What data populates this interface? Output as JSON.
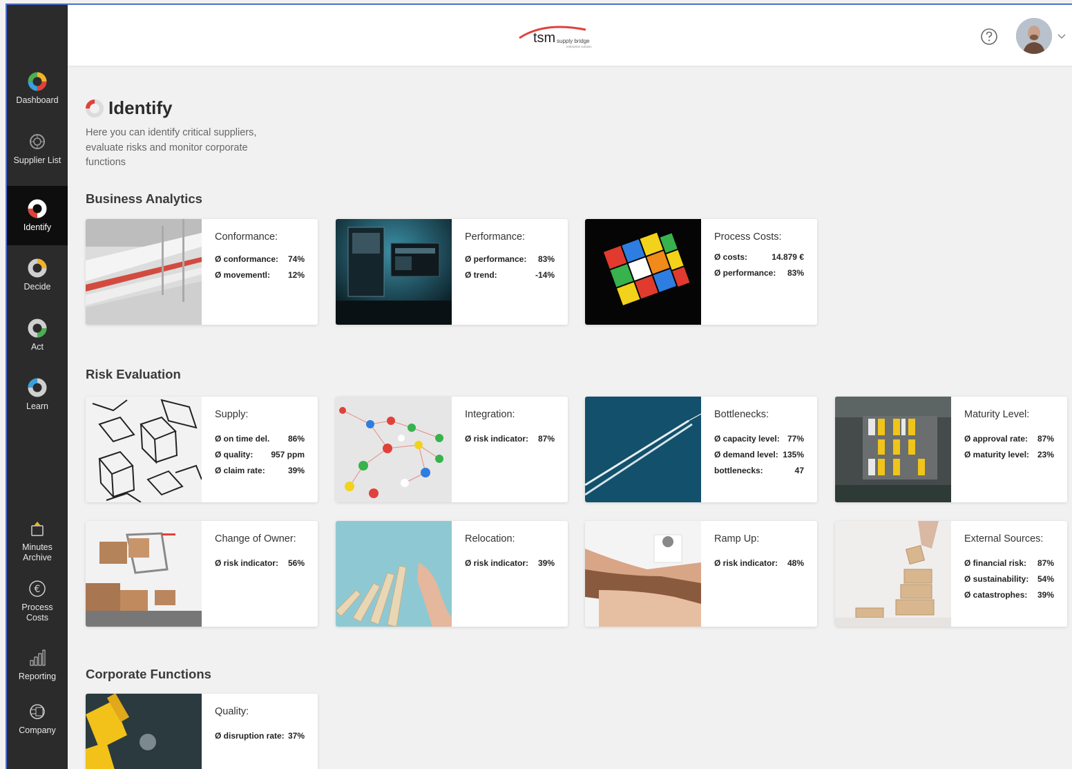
{
  "logo": {
    "brand": "tsm",
    "sub": "supply bridge",
    "tagline": "enterprise solution"
  },
  "sidebar": {
    "items": [
      {
        "label": "Dashboard",
        "icon": "dashboard-ring-icon"
      },
      {
        "label": "Supplier List",
        "icon": "supplier-list-icon"
      },
      {
        "label": "Identify",
        "icon": "identify-ring-icon"
      },
      {
        "label": "Decide",
        "icon": "decide-ring-icon"
      },
      {
        "label": "Act",
        "icon": "act-ring-icon"
      },
      {
        "label": "Learn",
        "icon": "learn-ring-icon"
      },
      {
        "label": "Minutes\nArchive",
        "line1": "Minutes",
        "line2": "Archive",
        "icon": "archive-icon"
      },
      {
        "label": "Process\nCosts",
        "line1": "Process",
        "line2": "Costs",
        "icon": "euro-icon"
      },
      {
        "label": "Reporting",
        "icon": "reporting-icon"
      },
      {
        "label": "Company",
        "icon": "company-icon"
      }
    ],
    "active": "Identify"
  },
  "header": {
    "help_icon": "help-icon",
    "avatar": "user-avatar"
  },
  "page": {
    "title": "Identify",
    "intro_line1": "Here you can identify critical suppliers,",
    "intro_line2": "evaluate risks and monitor corporate",
    "intro_line3": "functions"
  },
  "sections": {
    "business": {
      "title": "Business Analytics",
      "cards": [
        {
          "title": "Conformance:",
          "rows": [
            {
              "k": "Ø conformance:",
              "v": "74%"
            },
            {
              "k": "Ø movementl:",
              "v": "12%"
            }
          ]
        },
        {
          "title": "Performance:",
          "rows": [
            {
              "k": "Ø performance:",
              "v": "83%"
            },
            {
              "k": "Ø trend:",
              "v": "-14%"
            }
          ]
        },
        {
          "title": "Process Costs:",
          "rows": [
            {
              "k": "Ø costs:",
              "v": "14.879 €"
            },
            {
              "k": "Ø performance:",
              "v": "83%"
            }
          ]
        }
      ]
    },
    "risk": {
      "title": "Risk Evaluation",
      "cards": [
        {
          "title": "Supply:",
          "rows": [
            {
              "k": "Ø on time del.",
              "v": "86%"
            },
            {
              "k": "Ø quality:",
              "v": "957 ppm"
            },
            {
              "k": "Ø claim rate:",
              "v": "39%"
            }
          ]
        },
        {
          "title": "Integration:",
          "rows": [
            {
              "k": "Ø risk indicator:",
              "v": "87%"
            }
          ]
        },
        {
          "title": "Bottlenecks:",
          "rows": [
            {
              "k": "Ø capacity level:",
              "v": "77%"
            },
            {
              "k": "Ø demand level:",
              "v": "135%"
            },
            {
              "k": "bottlenecks:",
              "v": "47"
            }
          ]
        },
        {
          "title": "Maturity Level:",
          "rows": [
            {
              "k": "Ø approval rate:",
              "v": "87%"
            },
            {
              "k": "Ø maturity level:",
              "v": "23%"
            }
          ]
        },
        {
          "title": "Change of Owner:",
          "rows": [
            {
              "k": "Ø risk indicator:",
              "v": "56%"
            }
          ]
        },
        {
          "title": "Relocation:",
          "rows": [
            {
              "k": "Ø risk indicator:",
              "v": "39%"
            }
          ]
        },
        {
          "title": "Ramp Up:",
          "rows": [
            {
              "k": "Ø risk indicator:",
              "v": "48%"
            }
          ]
        },
        {
          "title": "External Sources:",
          "rows": [
            {
              "k": "Ø financial risk:",
              "v": "87%"
            },
            {
              "k": "Ø sustainability:",
              "v": "54%"
            },
            {
              "k": "Ø catastrophes:",
              "v": "39%"
            }
          ]
        }
      ]
    },
    "corporate": {
      "title": "Corporate Functions",
      "cards": [
        {
          "title": "Quality:",
          "rows": [
            {
              "k": "Ø disruption rate:",
              "v": "37%"
            }
          ]
        }
      ]
    }
  },
  "colors": {
    "sidebar": "#2b2b2b",
    "sidebar_active": "#0e0e0e",
    "accent_red": "#e0413a",
    "frame": "#4a6fd6"
  }
}
